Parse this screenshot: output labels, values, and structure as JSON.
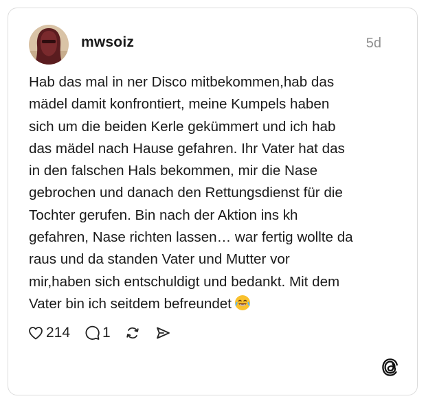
{
  "post": {
    "username": "mwsoiz",
    "timestamp": "5d",
    "text": "Hab das mal in ner Disco mitbekommen,hab das\nmädel damit konfrontiert, meine Kumpels  haben\nsich um die beiden Kerle gekümmert und ich hab\ndas mädel nach Hause gefahren. Ihr Vater hat das\nin den falschen Hals bekommen, mir die Nase\ngebrochen und danach den Rettungsdienst für die\nTochter gerufen. Bin nach der Aktion ins kh\ngefahren, Nase richten lassen… war fertig wollte da\nraus und da standen Vater und Mutter vor\nmir,haben sich entschuldigt und bedankt. Mit dem\nVater bin ich seitdem befreundet",
    "emoji": "face-with-tears-of-joy",
    "likes": "214",
    "comments": "1"
  },
  "icons": {
    "like": "heart-icon",
    "comment": "comment-bubble-icon",
    "repost": "repost-icon",
    "share": "send-icon",
    "app": "threads-logo-icon"
  },
  "colors": {
    "text": "#1a1a1a",
    "muted": "#8e8e8e",
    "border": "#dcdcdc"
  }
}
